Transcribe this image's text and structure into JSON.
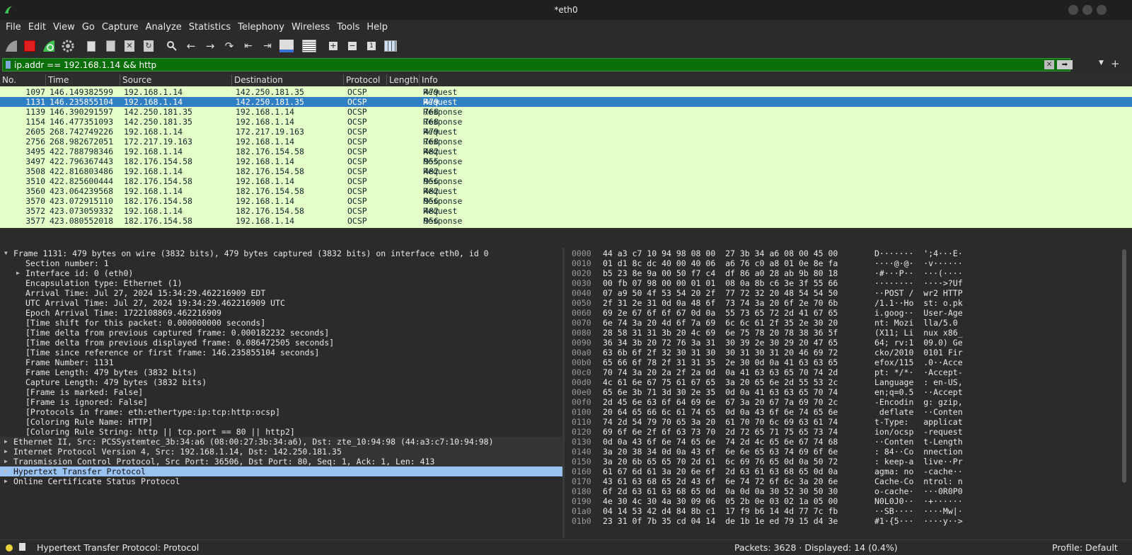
{
  "window": {
    "title": "*eth0"
  },
  "menu": [
    "File",
    "Edit",
    "View",
    "Go",
    "Capture",
    "Analyze",
    "Statistics",
    "Telephony",
    "Wireless",
    "Tools",
    "Help"
  ],
  "filter": {
    "value": "ip.addr == 192.168.1.14 && http",
    "clear_icon": "✕",
    "apply_icon": "➡"
  },
  "columns": {
    "no": "No.",
    "time": "Time",
    "source": "Source",
    "destination": "Destination",
    "protocol": "Protocol",
    "length": "Length",
    "info": "Info"
  },
  "packets": [
    {
      "no": "1097",
      "time": "146.149382599",
      "src": "192.168.1.14",
      "dst": "142.250.181.35",
      "proto": "OCSP",
      "len": "479",
      "info": "Request"
    },
    {
      "no": "1131",
      "time": "146.235855104",
      "src": "192.168.1.14",
      "dst": "142.250.181.35",
      "proto": "OCSP",
      "len": "479",
      "info": "Request"
    },
    {
      "no": "1139",
      "time": "146.390291597",
      "src": "142.250.181.35",
      "dst": "192.168.1.14",
      "proto": "OCSP",
      "len": "768",
      "info": "Response"
    },
    {
      "no": "1154",
      "time": "146.477351093",
      "src": "142.250.181.35",
      "dst": "192.168.1.14",
      "proto": "OCSP",
      "len": "768",
      "info": "Response"
    },
    {
      "no": "2605",
      "time": "268.742749226",
      "src": "192.168.1.14",
      "dst": "172.217.19.163",
      "proto": "OCSP",
      "len": "479",
      "info": "Request"
    },
    {
      "no": "2756",
      "time": "268.982672051",
      "src": "172.217.19.163",
      "dst": "192.168.1.14",
      "proto": "OCSP",
      "len": "768",
      "info": "Response"
    },
    {
      "no": "3495",
      "time": "422.788798346",
      "src": "192.168.1.14",
      "dst": "182.176.154.58",
      "proto": "OCSP",
      "len": "482",
      "info": "Request"
    },
    {
      "no": "3497",
      "time": "422.796367443",
      "src": "182.176.154.58",
      "dst": "192.168.1.14",
      "proto": "OCSP",
      "len": "955",
      "info": "Response"
    },
    {
      "no": "3508",
      "time": "422.816803486",
      "src": "192.168.1.14",
      "dst": "182.176.154.58",
      "proto": "OCSP",
      "len": "482",
      "info": "Request"
    },
    {
      "no": "3510",
      "time": "422.825600444",
      "src": "182.176.154.58",
      "dst": "192.168.1.14",
      "proto": "OCSP",
      "len": "956",
      "info": "Response"
    },
    {
      "no": "3560",
      "time": "423.064239568",
      "src": "192.168.1.14",
      "dst": "182.176.154.58",
      "proto": "OCSP",
      "len": "482",
      "info": "Request"
    },
    {
      "no": "3570",
      "time": "423.072915110",
      "src": "182.176.154.58",
      "dst": "192.168.1.14",
      "proto": "OCSP",
      "len": "956",
      "info": "Response"
    },
    {
      "no": "3572",
      "time": "423.073059332",
      "src": "192.168.1.14",
      "dst": "182.176.154.58",
      "proto": "OCSP",
      "len": "482",
      "info": "Request"
    },
    {
      "no": "3577",
      "time": "423.080552018",
      "src": "182.176.154.58",
      "dst": "192.168.1.14",
      "proto": "OCSP",
      "len": "956",
      "info": "Response"
    }
  ],
  "selected_packet_index": 1,
  "details": [
    {
      "text": "Frame 1131: 479 bytes on wire (3832 bits), 479 bytes captured (3832 bits) on interface eth0, id 0",
      "level": 0,
      "tri": "open"
    },
    {
      "text": "Section number: 1",
      "level": 1
    },
    {
      "text": "Interface id: 0 (eth0)",
      "level": 1,
      "tri": "closed"
    },
    {
      "text": "Encapsulation type: Ethernet (1)",
      "level": 1
    },
    {
      "text": "Arrival Time: Jul 27, 2024 15:34:29.462216909 EDT",
      "level": 1
    },
    {
      "text": "UTC Arrival Time: Jul 27, 2024 19:34:29.462216909 UTC",
      "level": 1
    },
    {
      "text": "Epoch Arrival Time: 1722108869.462216909",
      "level": 1
    },
    {
      "text": "[Time shift for this packet: 0.000000000 seconds]",
      "level": 1
    },
    {
      "text": "[Time delta from previous captured frame: 0.000182232 seconds]",
      "level": 1
    },
    {
      "text": "[Time delta from previous displayed frame: 0.086472505 seconds]",
      "level": 1
    },
    {
      "text": "[Time since reference or first frame: 146.235855104 seconds]",
      "level": 1
    },
    {
      "text": "Frame Number: 1131",
      "level": 1
    },
    {
      "text": "Frame Length: 479 bytes (3832 bits)",
      "level": 1
    },
    {
      "text": "Capture Length: 479 bytes (3832 bits)",
      "level": 1
    },
    {
      "text": "[Frame is marked: False]",
      "level": 1
    },
    {
      "text": "[Frame is ignored: False]",
      "level": 1
    },
    {
      "text": "[Protocols in frame: eth:ethertype:ip:tcp:http:ocsp]",
      "level": 1
    },
    {
      "text": "[Coloring Rule Name: HTTP]",
      "level": 1
    },
    {
      "text": "[Coloring Rule String: http || tcp.port == 80 || http2]",
      "level": 1
    },
    {
      "text": "Ethernet II, Src: PCSSystemtec_3b:34:a6 (08:00:27:3b:34:a6), Dst: zte_10:94:98 (44:a3:c7:10:94:98)",
      "level": 0,
      "tri": "closed",
      "sub": true
    },
    {
      "text": "Internet Protocol Version 4, Src: 192.168.1.14, Dst: 142.250.181.35",
      "level": 0,
      "tri": "closed",
      "sub": true
    },
    {
      "text": "Transmission Control Protocol, Src Port: 36506, Dst Port: 80, Seq: 1, Ack: 1, Len: 413",
      "level": 0,
      "tri": "closed",
      "sub": true
    },
    {
      "text": "Hypertext Transfer Protocol",
      "level": 0,
      "tri": "closed",
      "selected": true
    },
    {
      "text": "Online Certificate Status Protocol",
      "level": 0,
      "tri": "closed"
    }
  ],
  "hex": [
    {
      "off": "0000",
      "bytes": "44 a3 c7 10 94 98 08 00  27 3b 34 a6 08 00 45 00",
      "ascii": "D·······  ';4···E·"
    },
    {
      "off": "0010",
      "bytes": "01 d1 8c dc 40 00 40 06  a6 76 c0 a8 01 0e 8e fa",
      "ascii": "····@·@·  ·v······"
    },
    {
      "off": "0020",
      "bytes": "b5 23 8e 9a 00 50 f7 c4  df 86 a0 28 ab 9b 80 18",
      "ascii": "·#···P··  ···(····"
    },
    {
      "off": "0030",
      "bytes": "00 fb 07 98 00 00 01 01  08 0a 8b c6 3e 3f 55 66",
      "ascii": "········  ····>?Uf"
    },
    {
      "off": "0040",
      "bytes": "07 a9 50 4f 53 54 20 2f  77 72 32 20 48 54 54 50",
      "ascii": "··POST /  wr2 HTTP"
    },
    {
      "off": "0050",
      "bytes": "2f 31 2e 31 0d 0a 48 6f  73 74 3a 20 6f 2e 70 6b",
      "ascii": "/1.1··Ho  st: o.pk"
    },
    {
      "off": "0060",
      "bytes": "69 2e 67 6f 6f 67 0d 0a  55 73 65 72 2d 41 67 65",
      "ascii": "i.goog··  User-Age"
    },
    {
      "off": "0070",
      "bytes": "6e 74 3a 20 4d 6f 7a 69  6c 6c 61 2f 35 2e 30 20",
      "ascii": "nt: Mozi  lla/5.0 "
    },
    {
      "off": "0080",
      "bytes": "28 58 31 31 3b 20 4c 69  6e 75 78 20 78 38 36 5f",
      "ascii": "(X11; Li  nux x86_"
    },
    {
      "off": "0090",
      "bytes": "36 34 3b 20 72 76 3a 31  30 39 2e 30 29 20 47 65",
      "ascii": "64; rv:1  09.0) Ge"
    },
    {
      "off": "00a0",
      "bytes": "63 6b 6f 2f 32 30 31 30  30 31 30 31 20 46 69 72",
      "ascii": "cko/2010  0101 Fir"
    },
    {
      "off": "00b0",
      "bytes": "65 66 6f 78 2f 31 31 35  2e 30 0d 0a 41 63 63 65",
      "ascii": "efox/115  .0··Acce"
    },
    {
      "off": "00c0",
      "bytes": "70 74 3a 20 2a 2f 2a 0d  0a 41 63 63 65 70 74 2d",
      "ascii": "pt: */*·  ·Accept-"
    },
    {
      "off": "00d0",
      "bytes": "4c 61 6e 67 75 61 67 65  3a 20 65 6e 2d 55 53 2c",
      "ascii": "Language  : en-US,"
    },
    {
      "off": "00e0",
      "bytes": "65 6e 3b 71 3d 30 2e 35  0d 0a 41 63 63 65 70 74",
      "ascii": "en;q=0.5  ··Accept"
    },
    {
      "off": "00f0",
      "bytes": "2d 45 6e 63 6f 64 69 6e  67 3a 20 67 7a 69 70 2c",
      "ascii": "-Encodin  g: gzip,"
    },
    {
      "off": "0100",
      "bytes": "20 64 65 66 6c 61 74 65  0d 0a 43 6f 6e 74 65 6e",
      "ascii": " deflate  ··Conten"
    },
    {
      "off": "0110",
      "bytes": "74 2d 54 79 70 65 3a 20  61 70 70 6c 69 63 61 74",
      "ascii": "t-Type:   applicat"
    },
    {
      "off": "0120",
      "bytes": "69 6f 6e 2f 6f 63 73 70  2d 72 65 71 75 65 73 74",
      "ascii": "ion/ocsp  -request"
    },
    {
      "off": "0130",
      "bytes": "0d 0a 43 6f 6e 74 65 6e  74 2d 4c 65 6e 67 74 68",
      "ascii": "··Conten  t-Length"
    },
    {
      "off": "0140",
      "bytes": "3a 20 38 34 0d 0a 43 6f  6e 6e 65 63 74 69 6f 6e",
      "ascii": ": 84··Co  nnection"
    },
    {
      "off": "0150",
      "bytes": "3a 20 6b 65 65 70 2d 61  6c 69 76 65 0d 0a 50 72",
      "ascii": ": keep-a  live··Pr"
    },
    {
      "off": "0160",
      "bytes": "61 67 6d 61 3a 20 6e 6f  2d 63 61 63 68 65 0d 0a",
      "ascii": "agma: no  -cache··"
    },
    {
      "off": "0170",
      "bytes": "43 61 63 68 65 2d 43 6f  6e 74 72 6f 6c 3a 20 6e",
      "ascii": "Cache-Co  ntrol: n"
    },
    {
      "off": "0180",
      "bytes": "6f 2d 63 61 63 68 65 0d  0a 0d 0a 30 52 30 50 30",
      "ascii": "o-cache·  ···0R0P0"
    },
    {
      "off": "0190",
      "bytes": "4e 30 4c 30 4a 30 09 06  05 2b 0e 03 02 1a 05 00",
      "ascii": "N0L0J0··  ·+······"
    },
    {
      "off": "01a0",
      "bytes": "04 14 53 42 d4 84 8b c1  17 f9 b6 14 4d 77 7c fb",
      "ascii": "··SB····  ····Mw|·"
    },
    {
      "off": "01b0",
      "bytes": "23 31 0f 7b 35 cd 04 14  de 1b 1e ed 79 15 d4 3e",
      "ascii": "#1·{5···  ····y··>"
    }
  ],
  "status": {
    "field": "Hypertext Transfer Protocol: Protocol",
    "packets": "Packets: 3628 · Displayed: 14 (0.4%)",
    "profile": "Profile: Default"
  }
}
